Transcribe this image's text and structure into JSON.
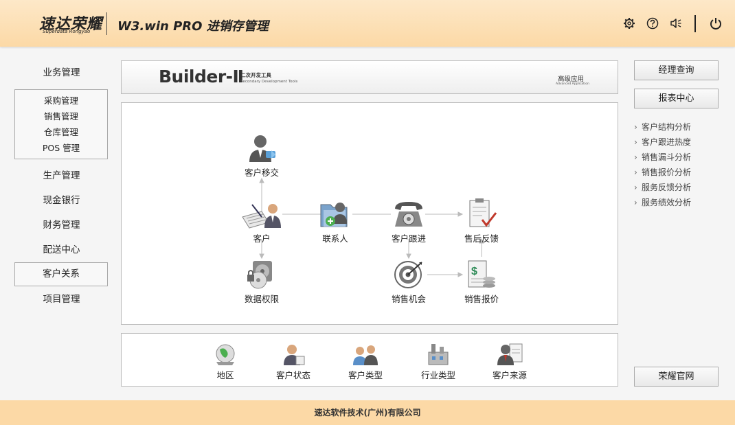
{
  "header": {
    "logo": "速达荣耀",
    "logo_sub": "Superdata Rongyao",
    "title": "W3.win  PRO  进销存管理",
    "icons": [
      "gear-icon",
      "help-icon",
      "speaker-mute-icon",
      "power-icon"
    ]
  },
  "sidebar": {
    "business": "业务管理",
    "sub_items": [
      "采购管理",
      "销售管理",
      "仓库管理",
      "POS 管理"
    ],
    "production": "生产管理",
    "cash_bank": "现金银行",
    "finance": "财务管理",
    "delivery": "配送中心",
    "crm": "客户关系",
    "project": "项目管理"
  },
  "banner": {
    "title": "Builder-Ⅱ",
    "sub_cn": "二次开发工具",
    "sub_en": "Secondary Development Tools",
    "advanced_cn": "高级应用",
    "advanced_en": "Advanced Application"
  },
  "flow": {
    "transfer": "客户移交",
    "customer": "客户",
    "contact": "联系人",
    "followup": "客户跟进",
    "aftersale": "售后反馈",
    "permission": "数据权限",
    "opportunity": "销售机会",
    "quote": "销售报价"
  },
  "bottom": {
    "region": "地区",
    "status": "客户状态",
    "type": "客户类型",
    "industry": "行业类型",
    "source": "客户来源"
  },
  "right": {
    "manager_query": "经理查询",
    "report_center": "报表中心",
    "reports": [
      "客户结构分析",
      "客户跟进热度",
      "销售漏斗分析",
      "销售报价分析",
      "服务反馈分析",
      "服务绩效分析"
    ],
    "official_site": "荣耀官网"
  },
  "footer": {
    "company": "速达软件技术(广州)有限公司"
  },
  "colors": {
    "header_bg": "#fcd9a6",
    "footer_bg": "#fcd9a6",
    "page_bg": "#f5f5f5"
  }
}
